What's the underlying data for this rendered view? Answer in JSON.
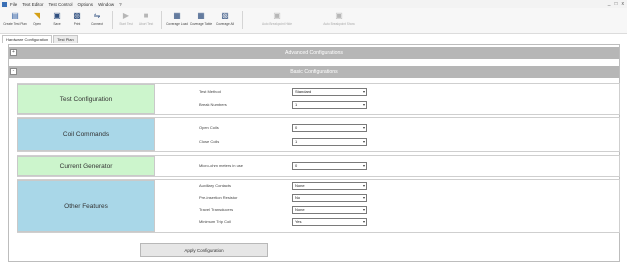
{
  "menubar": {
    "items": [
      "File",
      "Text Editor",
      "Test Control",
      "Options",
      "Window",
      "?"
    ],
    "window_controls": [
      "_",
      "□",
      "x"
    ]
  },
  "toolbar": {
    "buttons": [
      {
        "label": "Create Test Plan",
        "icon": "new-file-icon"
      },
      {
        "label": "Open",
        "icon": "open-folder-icon"
      },
      {
        "label": "Save",
        "icon": "save-icon"
      },
      {
        "label": "Print",
        "icon": "print-icon"
      },
      {
        "label": "Connect",
        "icon": "connect-icon"
      },
      {
        "label": "Start Test",
        "icon": "play-icon"
      },
      {
        "label": "Abort Test",
        "icon": "stop-icon"
      },
      {
        "label": "Coverage Load",
        "icon": "coverage-load-icon"
      },
      {
        "label": "Coverage Table",
        "icon": "coverage-table-icon"
      },
      {
        "label": "Coverage All",
        "icon": "coverage-all-icon"
      },
      {
        "label": "Auto Breakpoint Hide",
        "icon": "breakpoint-icon"
      },
      {
        "label": "Auto Breakpoint Show",
        "icon": "breakpoint-show-icon"
      }
    ]
  },
  "tabs": [
    "Hardware Configuration",
    "Test Plan"
  ],
  "sections": {
    "advanced": {
      "title": "Advanced Configurations",
      "toggle": "+"
    },
    "basic": {
      "title": "Basic Configurations",
      "toggle": "-"
    }
  },
  "groups": {
    "test_config": {
      "title": "Test Configuration",
      "fields": [
        {
          "label": "Test Method",
          "value": "Standard"
        },
        {
          "label": "Break Numbers",
          "value": "1"
        }
      ]
    },
    "coil_commands": {
      "title": "Coil Commands",
      "fields": [
        {
          "label": "Open Coils",
          "value": "0"
        },
        {
          "label": "Close Coils",
          "value": "1"
        }
      ]
    },
    "current_generator": {
      "title": "Current Generator",
      "fields": [
        {
          "label": "Micro-ohm meters in use",
          "value": "0"
        }
      ]
    },
    "other_features": {
      "title": "Other Features",
      "fields": [
        {
          "label": "Auxiliary Contacts",
          "value": "None"
        },
        {
          "label": "Pre-insertion Resistor",
          "value": "No"
        },
        {
          "label": "Travel Transducers",
          "value": "None"
        },
        {
          "label": "Minimum Trip Coil",
          "value": "Yes"
        }
      ]
    }
  },
  "apply_button": {
    "label": "Apply Configuration"
  },
  "colors": {
    "section_header": "#b6b6b6",
    "category_green": "#ccf5cc",
    "category_blue": "#a9d7e8"
  }
}
